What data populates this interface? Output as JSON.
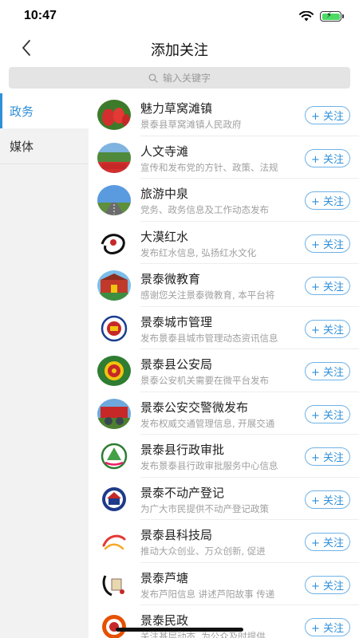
{
  "status_bar": {
    "time": "10:47"
  },
  "nav": {
    "title": "添加关注"
  },
  "search": {
    "placeholder": "输入关键字"
  },
  "sidebar": {
    "items": [
      {
        "label": "政务",
        "active": true
      },
      {
        "label": "媒体",
        "active": false
      }
    ]
  },
  "list": {
    "follow_label": "+ 关注",
    "items": [
      {
        "title": "魅力草窝滩镇",
        "desc": "景泰县草窝滩镇人民政府",
        "icon": "chili-pepper-avatar-icon"
      },
      {
        "title": "人文寺滩",
        "desc": "宣传和发布党的方针、政策、法规",
        "icon": "landscape-banner-avatar-icon"
      },
      {
        "title": "旅游中泉",
        "desc": "党务、政务信息及工作动态发布",
        "icon": "road-landscape-avatar-icon"
      },
      {
        "title": "大漠红水",
        "desc": "发布红水信息, 弘扬红水文化",
        "icon": "calligraphy-avatar-icon"
      },
      {
        "title": "景泰微教育",
        "desc": "感谢您关注景泰微教育, 本平台将",
        "icon": "school-building-avatar-icon"
      },
      {
        "title": "景泰城市管理",
        "desc": "发布景泰县城市管理动态资讯信息",
        "icon": "emblem-avatar-icon"
      },
      {
        "title": "景泰县公安局",
        "desc": "景泰公安机关需要在微平台发布",
        "icon": "police-badge-avatar-icon"
      },
      {
        "title": "景泰公安交警微发布",
        "desc": "发布权威交通管理信息, 开展交通",
        "icon": "traffic-police-avatar-icon"
      },
      {
        "title": "景泰县行政审批",
        "desc": "发布景泰县行政审批服务中心信息",
        "icon": "admin-approval-logo-icon"
      },
      {
        "title": "景泰不动产登记",
        "desc": "为广大市民提供不动产登记政策",
        "icon": "real-estate-logo-icon"
      },
      {
        "title": "景泰县科技局",
        "desc": "推动大众创业、万众创新, 促进",
        "icon": "tech-bureau-logo-icon"
      },
      {
        "title": "景泰芦塘",
        "desc": "发布芦阳信息 讲述芦阳故事 传递",
        "icon": "lutang-logo-icon"
      },
      {
        "title": "景泰民政",
        "desc": "关注基层动态, 为公众及时提供",
        "icon": "civil-affairs-logo-icon"
      }
    ]
  },
  "colors": {
    "accent": "#2f8fd8",
    "sidebar_bg": "#f2f2f2",
    "search_bg": "#e4e4e4"
  }
}
